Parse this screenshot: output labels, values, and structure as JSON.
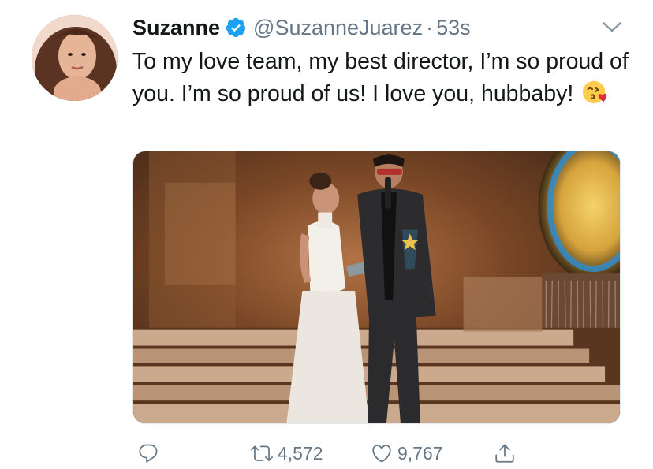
{
  "user": {
    "display_name": "Suzanne",
    "handle": "@SuzanneJuarez",
    "separator": "·",
    "time": "53s",
    "verified": true
  },
  "tweet": {
    "text": "To my love team, my best director, I’m so proud of you. I’m so proud of us! I love you, hubbaby!",
    "emoji": "kissing-face-with-heart-emoji"
  },
  "media": {
    "type": "photo",
    "alt": ""
  },
  "actions": {
    "reply_icon": "reply-icon",
    "retweet_icon": "retweet-icon",
    "retweet_count": "4,572",
    "like_icon": "heart-icon",
    "like_count": "9,767",
    "share_icon": "share-icon"
  },
  "colors": {
    "text": "#14171a",
    "secondary": "#657786",
    "verified": "#1da1f2",
    "border": "#e1e8ed"
  }
}
